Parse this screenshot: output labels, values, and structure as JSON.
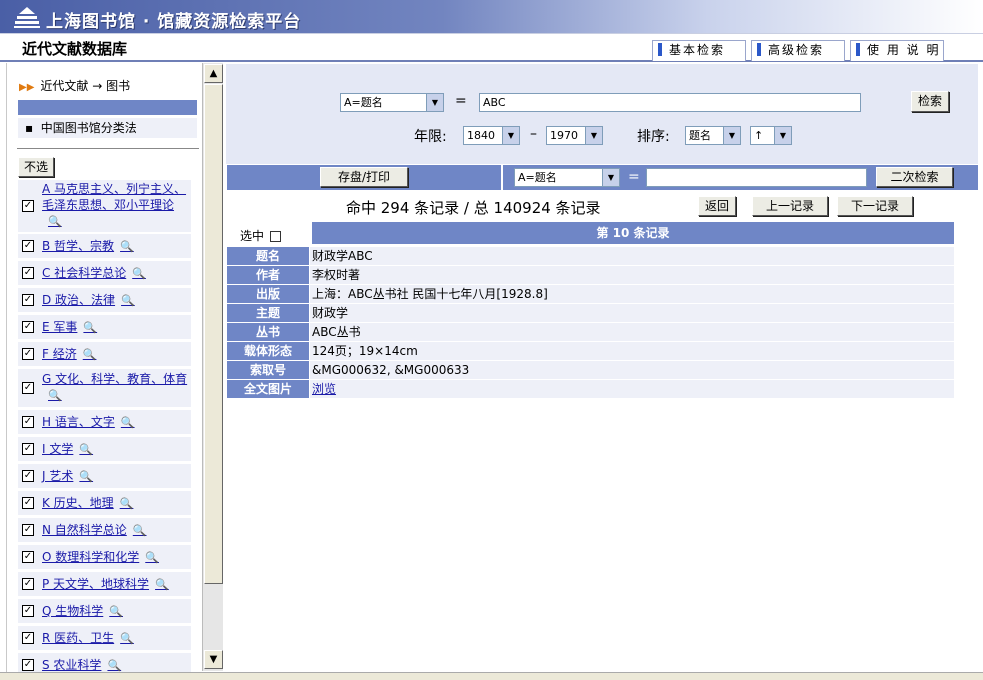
{
  "header": {
    "title": "上海图书馆 · 馆藏资源检索平台",
    "db_name": "近代文献数据库",
    "tabs": [
      {
        "label": "基本检索"
      },
      {
        "label": "高级检索"
      },
      {
        "label": "使 用 说 明"
      }
    ]
  },
  "sidebar": {
    "breadcrumb": "近代文献 → 图书",
    "classification": "中国图书馆分类法",
    "deselect_label": "不选",
    "categories": [
      {
        "label": "A 马克思主义、列宁主义、毛泽东思想、邓小平理论",
        "checked": true
      },
      {
        "label": "B 哲学、宗教",
        "checked": true
      },
      {
        "label": "C 社会科学总论",
        "checked": true
      },
      {
        "label": "D 政治、法律",
        "checked": true
      },
      {
        "label": "E 军事",
        "checked": true
      },
      {
        "label": "F 经济",
        "checked": true
      },
      {
        "label": "G 文化、科学、教育、体育",
        "checked": true
      },
      {
        "label": "H 语言、文字",
        "checked": true
      },
      {
        "label": "I 文学",
        "checked": true
      },
      {
        "label": "J 艺术",
        "checked": true
      },
      {
        "label": "K 历史、地理",
        "checked": true
      },
      {
        "label": "N 自然科学总论",
        "checked": true
      },
      {
        "label": "O 数理科学和化学",
        "checked": true
      },
      {
        "label": "P 天文学、地球科学",
        "checked": true
      },
      {
        "label": "Q 生物科学",
        "checked": true
      },
      {
        "label": "R 医药、卫生",
        "checked": true
      },
      {
        "label": "S 农业科学",
        "checked": true
      }
    ]
  },
  "search": {
    "field_select": "A=题名",
    "equals": "=",
    "query": "ABC",
    "search_button": "检索",
    "year_label": "年限:",
    "year_from": "1840",
    "dash": "–",
    "year_to": "1970",
    "sort_label": "排序:",
    "sort_field": "题名",
    "sort_dir": "↑"
  },
  "toolbar": {
    "save_print": "存盘/打印",
    "field_select": "A=题名",
    "equals": "=",
    "query": "",
    "secondary_button": "二次检索"
  },
  "results": {
    "hits": "命中 294 条记录 / 总 140924 条记录",
    "back": "返回",
    "prev": "上一记录",
    "next": "下一记录",
    "select_label": "选中",
    "record_header": "第 10 条记录"
  },
  "record": [
    {
      "key": "题名",
      "value": "财政学ABC"
    },
    {
      "key": "作者",
      "value": "李权时著"
    },
    {
      "key": "出版",
      "value": "上海：ABC丛书社 民国十七年八月[1928.8]"
    },
    {
      "key": "主题",
      "value": "财政学"
    },
    {
      "key": "丛书",
      "value": "ABC丛书"
    },
    {
      "key": "载体形态",
      "value": "124页；19×14cm"
    },
    {
      "key": "索取号",
      "value": "&MG000632, &MG000633"
    },
    {
      "key": "全文图片",
      "value": "浏览"
    }
  ]
}
